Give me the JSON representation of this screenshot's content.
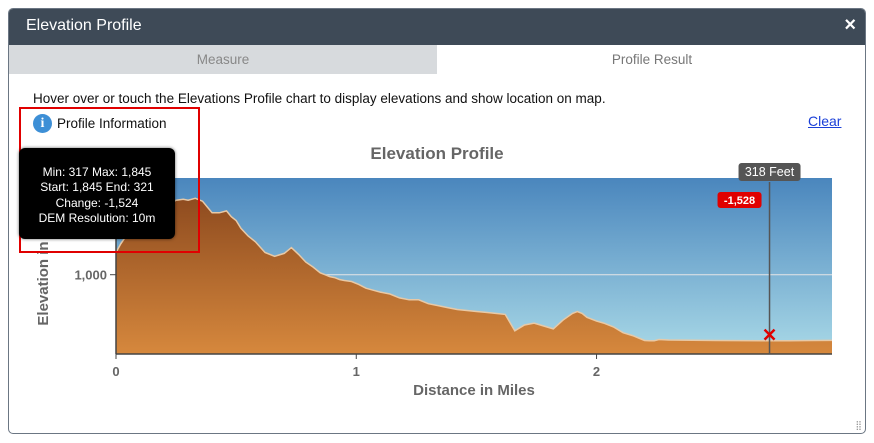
{
  "window": {
    "title": "Elevation Profile",
    "close_symbol": "×"
  },
  "tabs": [
    {
      "label": "Measure",
      "active": false
    },
    {
      "label": "Profile Result",
      "active": true
    }
  ],
  "hint": "Hover over or touch the Elevations Profile chart to display elevations and show location on map.",
  "info": {
    "label": "Profile Information",
    "icon": "info-icon"
  },
  "clear_label": "Clear",
  "profile_info": {
    "line1": "Min: 317 Max: 1,845",
    "line2": "Start: 1,845 End: 321",
    "line3": "Change: -1,524",
    "line4": "DEM Resolution: 10m"
  },
  "colors": {
    "sky_top": "#4a86bd",
    "sky_bottom": "#a9d9e7",
    "terrain_top": "#8e4b1f",
    "terrain_bottom": "#d6883d",
    "marker": "#e00000"
  },
  "chart_data": {
    "type": "area",
    "title": "Elevation Profile",
    "xlabel": "Distance in Miles",
    "ylabel": "Elevation in Feet",
    "xlim": [
      0,
      2.98
    ],
    "ylim": [
      180,
      2000
    ],
    "xticks": [
      "0",
      "1",
      "2"
    ],
    "yticks": [
      "1,000"
    ],
    "x": [
      0,
      0.02,
      0.05,
      0.1,
      0.15,
      0.2,
      0.25,
      0.28,
      0.3,
      0.33,
      0.36,
      0.38,
      0.4,
      0.43,
      0.46,
      0.48,
      0.5,
      0.52,
      0.55,
      0.58,
      0.62,
      0.66,
      0.7,
      0.73,
      0.76,
      0.79,
      0.82,
      0.85,
      0.87,
      0.89,
      0.91,
      0.93,
      0.95,
      0.98,
      1.01,
      1.04,
      1.07,
      1.1,
      1.14,
      1.18,
      1.22,
      1.26,
      1.3,
      1.34,
      1.38,
      1.42,
      1.46,
      1.5,
      1.54,
      1.58,
      1.62,
      1.66,
      1.7,
      1.74,
      1.78,
      1.82,
      1.86,
      1.9,
      1.92,
      1.94,
      1.96,
      1.98,
      2.0,
      2.03,
      2.07,
      2.11,
      2.15,
      2.18,
      2.2,
      2.22,
      2.24,
      2.26,
      2.3,
      2.4,
      2.5,
      2.6,
      2.7,
      2.8,
      2.9,
      2.98
    ],
    "elevation": [
      1230,
      1320,
      1430,
      1560,
      1640,
      1700,
      1770,
      1780,
      1770,
      1790,
      1760,
      1700,
      1640,
      1640,
      1660,
      1600,
      1560,
      1480,
      1400,
      1340,
      1230,
      1190,
      1220,
      1280,
      1210,
      1130,
      1080,
      1020,
      1000,
      980,
      970,
      950,
      940,
      930,
      900,
      860,
      840,
      820,
      800,
      760,
      740,
      740,
      700,
      680,
      660,
      640,
      630,
      620,
      610,
      600,
      590,
      420,
      480,
      500,
      470,
      440,
      530,
      600,
      620,
      600,
      560,
      540,
      520,
      500,
      460,
      400,
      370,
      340,
      320,
      318,
      317,
      330,
      325,
      322,
      320,
      319,
      318,
      318,
      320,
      321
    ],
    "cursor": {
      "x": 2.72,
      "label": "318 Feet",
      "change_label": "-1,528"
    }
  }
}
